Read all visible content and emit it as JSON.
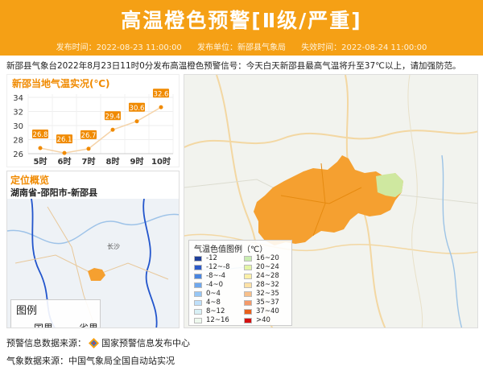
{
  "header": {
    "title": "高温橙色预警[Ⅱ级/严重]",
    "publish_time": "发布时间：2022-08-23 11:00:00",
    "publisher": "发布单位：新邵县气象局",
    "expire_time": "失效时间：2022-08-24 11:00:00"
  },
  "description": "新邵县气象台2022年8月23日11时0分发布高温橙色预警信号：今天白天新邵县最高气温将升至37℃以上，请加强防范。",
  "temperature_panel": {
    "title": "新邵当地气温实况(℃)"
  },
  "chart_data": {
    "type": "line",
    "title": "新邵当地气温实况(℃)",
    "categories": [
      "5时",
      "6时",
      "7时",
      "8时",
      "9时",
      "10时"
    ],
    "values": [
      26.8,
      26.1,
      26.7,
      29.4,
      30.6,
      32.6
    ],
    "value_labels": [
      "26.8",
      "26.1",
      "26.7",
      "29.4",
      "30.6",
      "32.6"
    ],
    "y_ticks": [
      "26",
      "28",
      "30",
      "32",
      "34"
    ],
    "ylim": [
      26,
      34
    ],
    "grid": true,
    "colors": {
      "line": "#f5d3a8",
      "label_bg": "#f08a00"
    }
  },
  "location": {
    "title": "定位概览",
    "name": "湖南省-邵阳市-新邵县",
    "legend_title": "图例",
    "legend_items": [
      {
        "label": "国界",
        "color": "#c0392b"
      },
      {
        "label": "省界",
        "color": "#2255cc"
      }
    ],
    "map_labels": [
      "长沙"
    ]
  },
  "temp_map": {
    "legend_title": "气温色值图例（℃）",
    "legend_left": [
      {
        "label": "-12",
        "color": "#1f3f99"
      },
      {
        "label": "-12~-8",
        "color": "#2d5bc8"
      },
      {
        "label": "-8~-4",
        "color": "#4a86e0"
      },
      {
        "label": "-4~0",
        "color": "#6fa8ee"
      },
      {
        "label": "0~4",
        "color": "#97c7f5"
      },
      {
        "label": "4~8",
        "color": "#bfe0fa"
      },
      {
        "label": "8~12",
        "color": "#d8f0f5"
      },
      {
        "label": "12~16",
        "color": "#eef9ee"
      }
    ],
    "legend_right": [
      {
        "label": "16~20",
        "color": "#c8ecb0"
      },
      {
        "label": "20~24",
        "color": "#e4f5a6"
      },
      {
        "label": "24~28",
        "color": "#fbf0a8"
      },
      {
        "label": "28~32",
        "color": "#fde2a6"
      },
      {
        "label": "32~35",
        "color": "#f8c08a"
      },
      {
        "label": "35~37",
        "color": "#f49a6a"
      },
      {
        "label": "37~40",
        "color": "#e8601c"
      },
      {
        "label": ">40",
        "color": "#d41010"
      }
    ]
  },
  "sources": {
    "warning": "预警信息数据来源：",
    "warning_org": "国家预警信息发布中心",
    "weather": "气象数据来源：中国气象局全国自动站实况"
  }
}
